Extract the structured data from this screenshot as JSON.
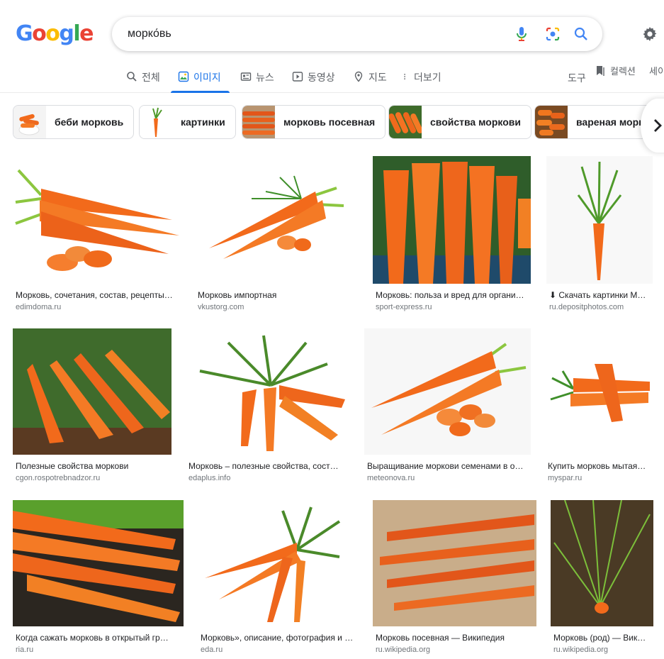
{
  "logo": {
    "letters": [
      "G",
      "o",
      "o",
      "g",
      "l",
      "e"
    ]
  },
  "search": {
    "query": "морко́вь"
  },
  "tabs": [
    {
      "label": "전체",
      "icon": "search-icon"
    },
    {
      "label": "이미지",
      "icon": "image-icon",
      "active": true
    },
    {
      "label": "뉴스",
      "icon": "news-icon"
    },
    {
      "label": "동영상",
      "icon": "video-icon"
    },
    {
      "label": "지도",
      "icon": "map-pin-icon"
    },
    {
      "label": "더보기",
      "icon": "more-dots-icon"
    }
  ],
  "toolbar": {
    "tools": "도구",
    "collections": "컬렉션",
    "safesearch": "세이"
  },
  "chips": [
    {
      "label": "беби морковь",
      "thumb": "baby-carrots"
    },
    {
      "label": "картинки",
      "thumb": "single-carrot"
    },
    {
      "label": "морковь посевная",
      "thumb": "carrots-on-wood"
    },
    {
      "label": "свойства моркови",
      "thumb": "carrot-pile"
    },
    {
      "label": "вареная морковь",
      "thumb": "boiled-carrots"
    }
  ],
  "results": [
    {
      "title": "Морковь, сочетания, состав, рецепты…",
      "site": "edimdoma.ru",
      "bg": "#ffffff"
    },
    {
      "title": "Морковь импортная",
      "site": "vkustorg.com",
      "bg": "#ffffff"
    },
    {
      "title": "Морковь: польза и вред для органи…",
      "site": "sport-express.ru",
      "bg": "#2f5d2a"
    },
    {
      "title": "⬇ Скачать картинки М…",
      "site": "ru.depositphotos.com",
      "bg": "#ffffff"
    },
    {
      "title": "Полезные свойства моркови",
      "site": "cgon.rospotrebnadzor.ru",
      "bg": "#3f6b2c"
    },
    {
      "title": "Морковь – полезные свойства, сост…",
      "site": "edaplus.info",
      "bg": "#ffffff"
    },
    {
      "title": "Выращивание моркови семенами в о…",
      "site": "meteonova.ru",
      "bg": "#f7f7f7"
    },
    {
      "title": "Купить морковь мытая…",
      "site": "myspar.ru",
      "bg": "#ffffff"
    },
    {
      "title": "Когда сажать морковь в открытый гр…",
      "site": "ria.ru",
      "bg": "#2b2620"
    },
    {
      "title": "Морковь», описание, фотография и …",
      "site": "eda.ru",
      "bg": "#ffffff"
    },
    {
      "title": "Морковь посевная — Википедия",
      "site": "ru.wikipedia.org",
      "bg": "#c9ad8a"
    },
    {
      "title": "Морковь (род) — Вик…",
      "site": "ru.wikipedia.org",
      "bg": "#4a3a25"
    }
  ],
  "colors": {
    "accent": "#1a73e8",
    "carrot": "#f26a1b",
    "leaf": "#5aa02c"
  }
}
